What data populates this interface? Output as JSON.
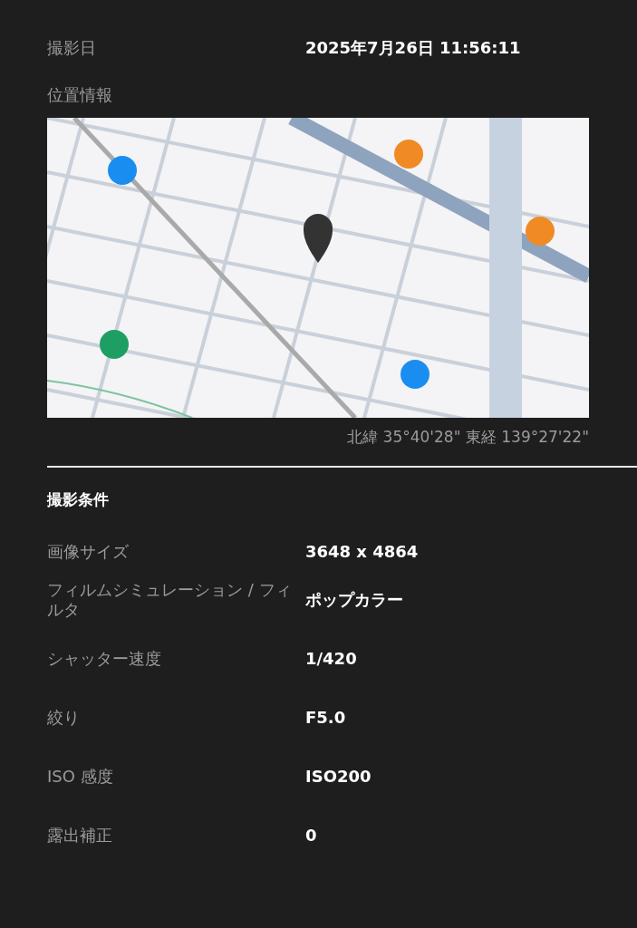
{
  "capture_date": {
    "label": "撮影日",
    "value": "2025年7月26日 11:56:11"
  },
  "location": {
    "label": "位置情報",
    "coordinates": "北緯 35°40'28\" 東経 139°27'22\""
  },
  "shooting_conditions": {
    "title": "撮影条件",
    "rows": [
      {
        "label": "画像サイズ",
        "value": "3648 x 4864"
      },
      {
        "label": "フィルムシミュレーション / フィルタ",
        "value": "ポップカラー"
      },
      {
        "label": "シャッター速度",
        "value": "1/420"
      },
      {
        "label": "絞り",
        "value": "F5.0"
      },
      {
        "label": "ISO 感度",
        "value": "ISO200"
      },
      {
        "label": "露出補正",
        "value": "0"
      }
    ]
  }
}
